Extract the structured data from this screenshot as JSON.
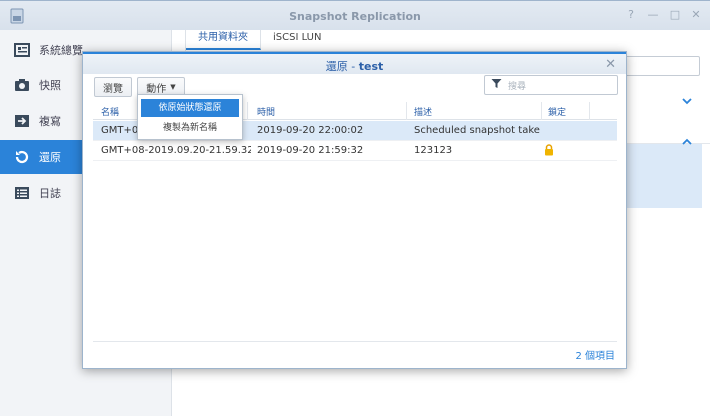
{
  "app": {
    "title": "Snapshot Replication",
    "window_controls": [
      "?",
      "—",
      "□",
      "✕"
    ]
  },
  "sidebar": {
    "items": [
      {
        "label": "系統總覽",
        "icon": "overview-icon"
      },
      {
        "label": "快照",
        "icon": "camera-icon"
      },
      {
        "label": "複寫",
        "icon": "replication-icon"
      },
      {
        "label": "還原",
        "icon": "restore-icon",
        "active": true
      },
      {
        "label": "日誌",
        "icon": "log-icon"
      }
    ]
  },
  "main": {
    "tabs": [
      "共用資料夾",
      "iSCSI LUN"
    ]
  },
  "dialog": {
    "title_prefix": "還原 - ",
    "title_name": "test",
    "close": "✕",
    "toolbar": {
      "browse": "瀏覽",
      "action": "動作",
      "search_placeholder": "搜尋"
    },
    "columns": [
      "名稱",
      "時間",
      "描述",
      "鎖定"
    ],
    "rows": [
      {
        "name": "GMT+08",
        "time": "2019-09-20 22:00:02",
        "desc": "Scheduled snapshot take...",
        "locked": false
      },
      {
        "name": "GMT+08-2019.09.20-21.59.32",
        "time": "2019-09-20 21:59:32",
        "desc": "123123",
        "locked": true
      }
    ],
    "count": "2 個項目"
  },
  "action_menu": {
    "items": [
      "依原始狀態還原",
      "複製為新名稱"
    ]
  }
}
